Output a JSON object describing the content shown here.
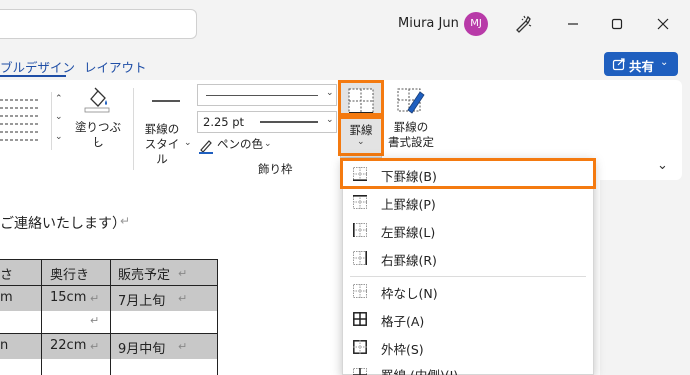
{
  "titlebar": {
    "user_name": "Miura Jun",
    "avatar_initials": "MJ"
  },
  "tabs": {
    "table_design": "ブルデザイン",
    "layout": "レイアウト"
  },
  "share_button": {
    "label": "共有"
  },
  "ribbon": {
    "shading_label": "塗りつぶし",
    "border_style_label_1": "罫線の",
    "border_style_label_2": "スタイル",
    "pen_weight_value": "2.25 pt",
    "pen_color_label": "ペンの色",
    "group_label": "飾り枠",
    "borders_button_label": "罫線",
    "border_painter_label_1": "罫線の",
    "border_painter_label_2": "書式設定"
  },
  "document": {
    "body_text": "ご連絡いたします）",
    "table": {
      "headers": [
        "さ",
        "奥行き",
        "販売予定"
      ],
      "rows": [
        [
          "m",
          "15cm",
          "7月上旬"
        ],
        [
          "n",
          "22cm",
          "9月中旬"
        ]
      ]
    }
  },
  "borders_menu": {
    "items": [
      {
        "label": "下罫線(B)",
        "icon": "bottom-border-icon"
      },
      {
        "label": "上罫線(P)",
        "icon": "top-border-icon"
      },
      {
        "label": "左罫線(L)",
        "icon": "left-border-icon"
      },
      {
        "label": "右罫線(R)",
        "icon": "right-border-icon"
      },
      {
        "label": "枠なし(N)",
        "icon": "no-border-icon"
      },
      {
        "label": "格子(A)",
        "icon": "all-borders-icon"
      },
      {
        "label": "外枠(S)",
        "icon": "outside-borders-icon"
      },
      {
        "label": "罫線 (内側)(I)",
        "icon": "inside-borders-icon"
      }
    ]
  },
  "colors": {
    "highlight": "#f47a10",
    "accent": "#1f5fbf",
    "avatar": "#b83aa8"
  }
}
